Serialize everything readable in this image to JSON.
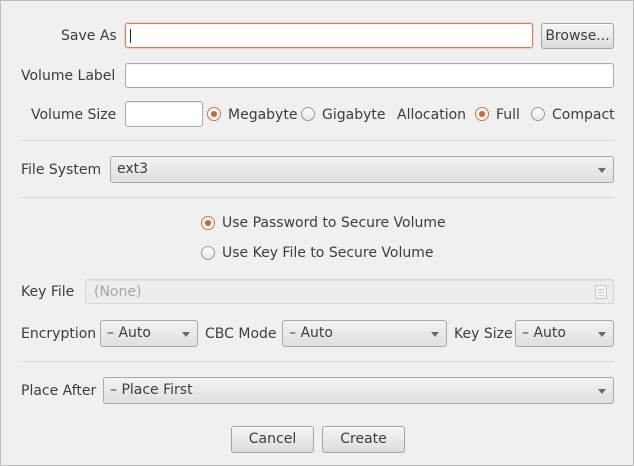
{
  "save_as": {
    "label": "Save As",
    "value": "",
    "browse_label": "Browse..."
  },
  "volume_label": {
    "label": "Volume Label",
    "value": ""
  },
  "volume_size": {
    "label": "Volume Size",
    "value": "",
    "unit_options": [
      "Megabyte",
      "Gigabyte"
    ],
    "unit_selected": "Megabyte"
  },
  "allocation": {
    "label": "Allocation",
    "options": [
      "Full",
      "Compact"
    ],
    "selected": "Full"
  },
  "file_system": {
    "label": "File System",
    "value": "ext3"
  },
  "security": {
    "options": [
      "Use Password to Secure Volume",
      "Use Key File to Secure Volume"
    ],
    "selected": "Use Password to Secure Volume"
  },
  "key_file": {
    "label": "Key File",
    "placeholder": "(None)",
    "enabled": false
  },
  "encryption": {
    "label": "Encryption",
    "value": "– Auto"
  },
  "cbc_mode": {
    "label": "CBC Mode",
    "value": "– Auto"
  },
  "key_size": {
    "label": "Key Size",
    "value": "– Auto"
  },
  "place_after": {
    "label": "Place After",
    "value": "– Place First"
  },
  "buttons": {
    "cancel": "Cancel",
    "create": "Create"
  },
  "colors": {
    "accent": "#e05b2c",
    "focus_border": "#e07a52",
    "background": "#f0f0f0"
  },
  "icons": {
    "key_file_icon": "file-icon"
  }
}
